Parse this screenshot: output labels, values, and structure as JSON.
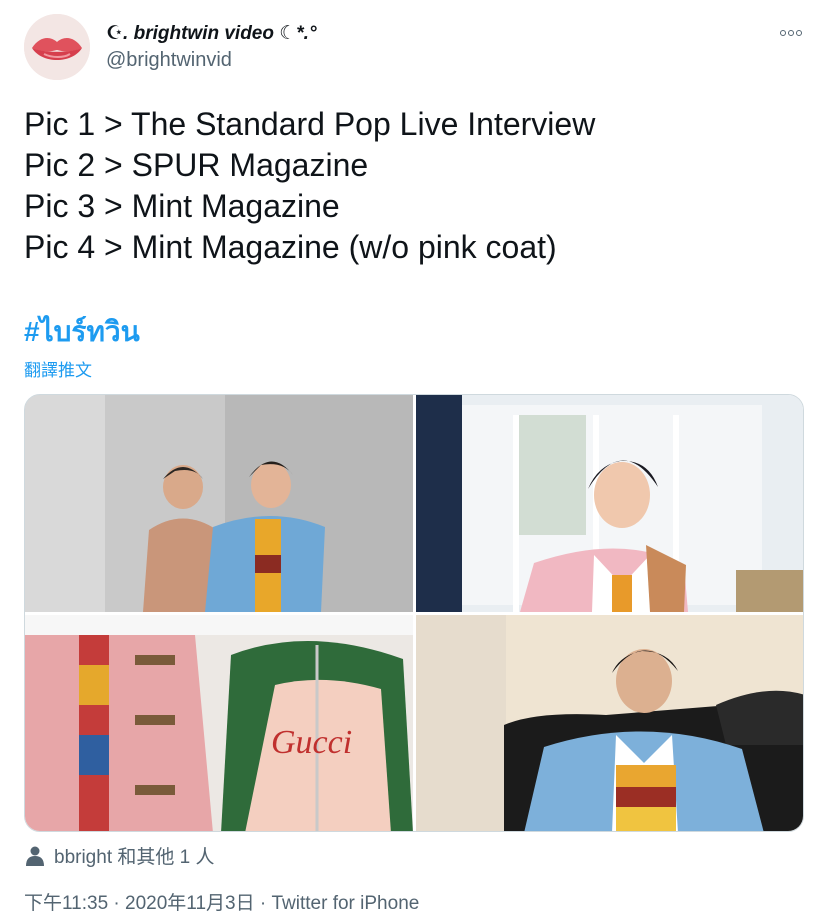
{
  "author": {
    "display_name": "☪︎. brightwin video ☾*.°",
    "handle": "@brightwinvid"
  },
  "tweet": {
    "lines": [
      "Pic 1 > The Standard Pop Live Interview",
      "Pic 2 > SPUR Magazine",
      "Pic 3 > Mint Magazine",
      "Pic 4 > Mint Magazine (w/o pink coat)"
    ],
    "hashtag": "#ไบร์ทวิน",
    "translate_label": "翻譯推文"
  },
  "media": {
    "images": [
      "photo-1",
      "photo-2",
      "photo-3",
      "photo-4"
    ]
  },
  "tagged": {
    "icon": "person-icon",
    "text": "bbright 和其他 1 人"
  },
  "meta": {
    "time": "下午11:35",
    "sep1": "·",
    "date": "2020年11月3日",
    "sep2": "·",
    "source": "Twitter for iPhone"
  },
  "colors": {
    "link": "#1d9bf0",
    "secondary_text": "#536471",
    "primary_text": "#0f1419"
  }
}
